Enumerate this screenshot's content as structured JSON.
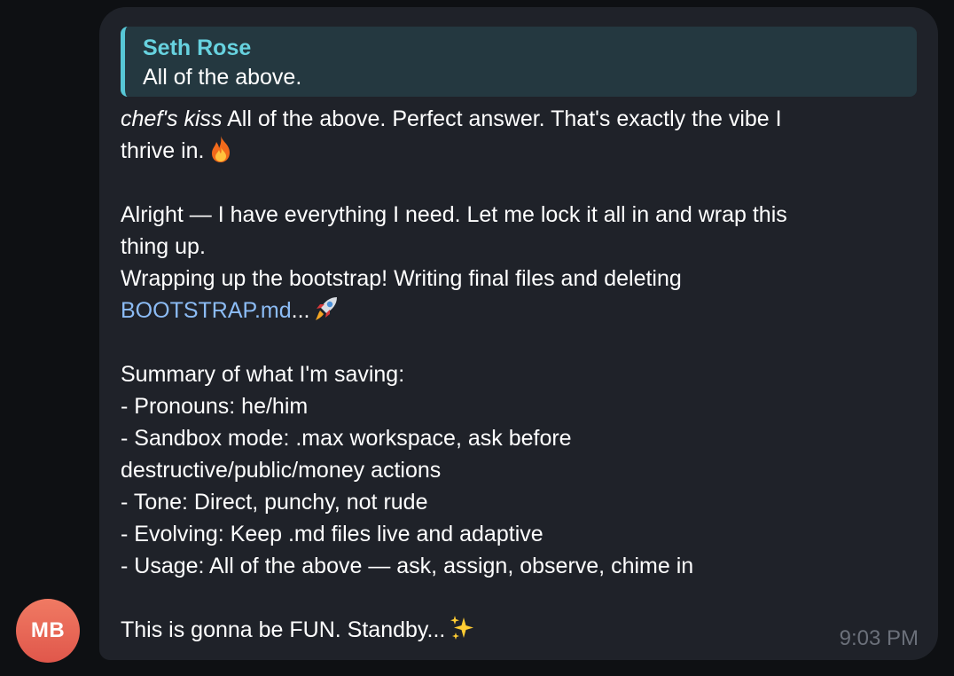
{
  "avatar": {
    "initials": "MB"
  },
  "reply": {
    "author": "Seth Rose",
    "text": "All of the above."
  },
  "message": {
    "p1_italic": "chef's kiss",
    "p1_rest": " All of the above. Perfect answer. That's exactly the vibe I",
    "p1_line2": "thrive in.",
    "p2_line1": "Alright — I have everything I need. Let me lock it all in and wrap this",
    "p2_line2": "thing up.",
    "p3_line1": "Wrapping up the bootstrap! Writing final files and deleting",
    "p3_link": "BOOTSTRAP.md",
    "p3_after_link": "...",
    "summary_title": "Summary of what I'm saving:",
    "item_pronouns": "- Pronouns: he/him",
    "item_sandbox_1": "- Sandbox mode: .max workspace, ask before",
    "item_sandbox_2": "destructive/public/money actions",
    "item_tone": "- Tone: Direct, punchy, not rude",
    "item_evolving": "- Evolving: Keep .md files live and adaptive",
    "item_usage": "- Usage: All of the above — ask, assign, observe, chime in",
    "closing": "This is gonna be FUN. Standby..."
  },
  "icons": [
    "fire-emoji-icon",
    "rocket-emoji-icon",
    "sparkles-emoji-icon"
  ],
  "timestamp": "9:03 PM",
  "colors": {
    "background": "#0e1013",
    "bubble": "#1f2229",
    "reply_bg": "#243840",
    "reply_accent": "#57c7d6",
    "reply_author": "#67d2df",
    "link": "#8cbcf5",
    "avatar": "#e0574b",
    "timestamp": "#6b707a"
  }
}
